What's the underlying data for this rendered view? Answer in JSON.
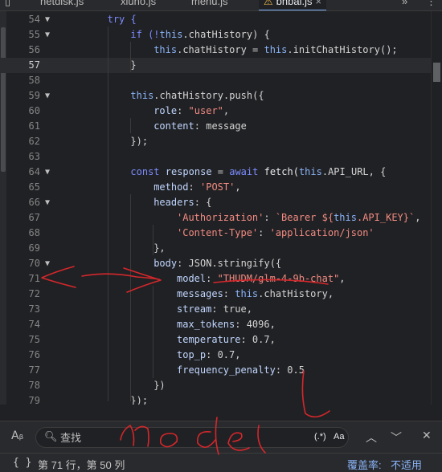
{
  "tabs": [
    {
      "label": "netdisk.js",
      "active": false
    },
    {
      "label": "xiuno.js",
      "active": false
    },
    {
      "label": "menu.js",
      "active": false
    },
    {
      "label": "bnbai.js",
      "active": true,
      "warning": true
    }
  ],
  "tab_more_icon": "more-vertical-icon",
  "lines": [
    {
      "n": "54",
      "fold": true
    },
    {
      "n": "55",
      "fold": true
    },
    {
      "n": "56",
      "fold": false
    },
    {
      "n": "57",
      "fold": false
    },
    {
      "n": "58",
      "fold": false
    },
    {
      "n": "59",
      "fold": true
    },
    {
      "n": "60",
      "fold": false
    },
    {
      "n": "61",
      "fold": false
    },
    {
      "n": "62",
      "fold": false
    },
    {
      "n": "63",
      "fold": false
    },
    {
      "n": "64",
      "fold": true
    },
    {
      "n": "65",
      "fold": false
    },
    {
      "n": "66",
      "fold": true
    },
    {
      "n": "67",
      "fold": false
    },
    {
      "n": "68",
      "fold": false
    },
    {
      "n": "69",
      "fold": false
    },
    {
      "n": "70",
      "fold": true
    },
    {
      "n": "71",
      "fold": false
    },
    {
      "n": "72",
      "fold": false
    },
    {
      "n": "73",
      "fold": false
    },
    {
      "n": "74",
      "fold": false
    },
    {
      "n": "75",
      "fold": false
    },
    {
      "n": "76",
      "fold": false
    },
    {
      "n": "77",
      "fold": false
    },
    {
      "n": "78",
      "fold": false
    },
    {
      "n": "79",
      "fold": false
    }
  ],
  "code": {
    "l54": "try {",
    "l55a": "if (!",
    "l55b": "this",
    "l55c": ".chatHistory) {",
    "l56a": "this",
    "l56b": ".chatHistory = ",
    "l56c": "this",
    "l56d": ".initChatHistory();",
    "l57": "}",
    "l59a": "this",
    "l59b": ".chatHistory.push({",
    "l60a": "role",
    "l60b": ": ",
    "l60c": "\"user\"",
    "l60d": ",",
    "l61a": "content",
    "l61b": ": message",
    "l62": "});",
    "l64a": "const ",
    "l64b": "response",
    "l64c": " = ",
    "l64d": "await ",
    "l64e": "fetch(",
    "l64f": "this",
    "l64g": ".API_URL, {",
    "l65a": "method",
    "l65b": ": ",
    "l65c": "'POST'",
    "l65d": ",",
    "l66a": "headers",
    "l66b": ": {",
    "l67a": "'Authorization'",
    "l67b": ": ",
    "l67c": "`Bearer ${",
    "l67d": "this",
    "l67e": ".API_KEY}`",
    "l67f": ",",
    "l68a": "'Content-Type'",
    "l68b": ": ",
    "l68c": "'application/json'",
    "l69": "},",
    "l70a": "body",
    "l70b": ": JSON.stringify({",
    "l71a": "model",
    "l71b": ": ",
    "l71c": "\"THUDM/glm-4-9b-chat\"",
    "l71d": ",",
    "l72a": "messages",
    "l72b": ": ",
    "l72c": "this",
    "l72d": ".chatHistory,",
    "l73a": "stream",
    "l73b": ": true,",
    "l74a": "max_tokens",
    "l74b": ": 4096,",
    "l75a": "temperature",
    "l75b": ": 0.7,",
    "l76a": "top_p",
    "l76b": ": 0.7,",
    "l77a": "frequency_penalty",
    "l77b": ": 0.5",
    "l78": "})",
    "l79": "});"
  },
  "search": {
    "placeholder": "查找",
    "regex_label": "(.*)",
    "case_label": "Aa"
  },
  "status": {
    "braces": "{ }",
    "position": "第 71 行，第 50 列",
    "coverage_label": "覆盖率:",
    "coverage_value": "不适用"
  },
  "annotation": {
    "handwriting": "model",
    "color": "#d4272b"
  },
  "colors": {
    "background": "#202124",
    "keyword": "#7c8cff",
    "string": "#f28b82",
    "accent": "#8ab4f8"
  }
}
